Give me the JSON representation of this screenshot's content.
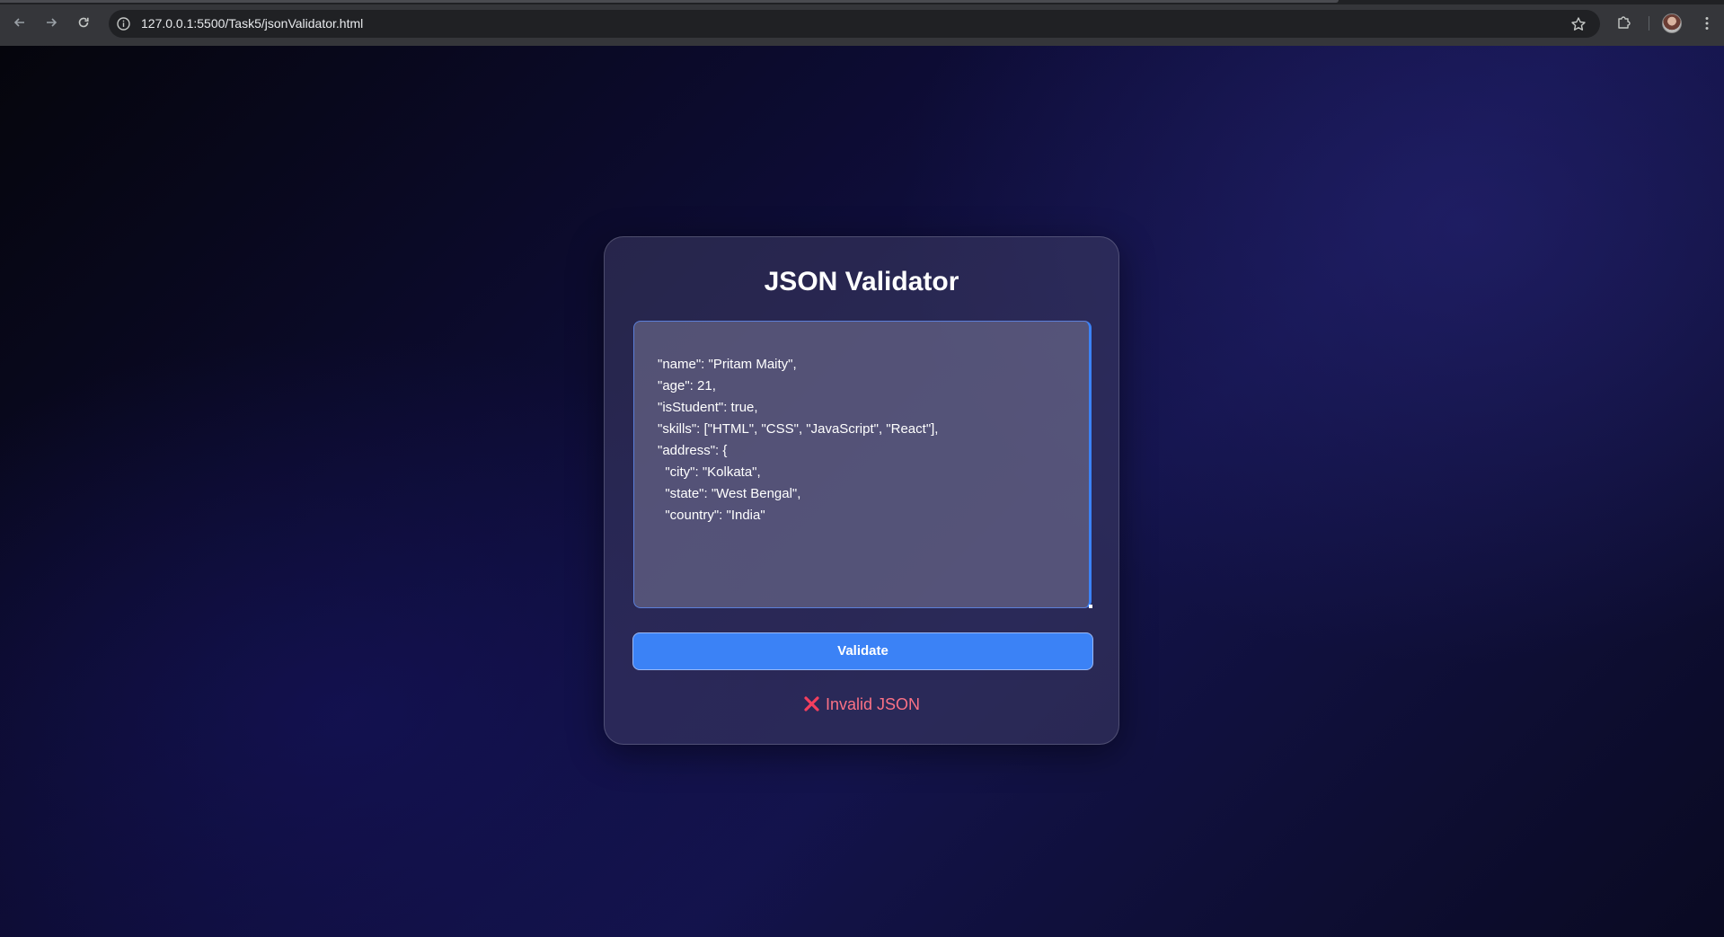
{
  "browser": {
    "url": "127.0.0.1:5500/Task5/jsonValidator.html",
    "icons": {
      "back": "arrow-left-icon",
      "forward": "arrow-right-icon",
      "reload": "reload-icon",
      "site_info": "info-icon",
      "bookmark": "star-icon",
      "extensions": "puzzle-icon",
      "profile": "avatar",
      "menu": "kebab-menu-icon"
    }
  },
  "app": {
    "title": "JSON Validator",
    "editor_value": "\"name\": \"Pritam Maity\",\n\"age\": 21,\n\"isStudent\": true,\n\"skills\": [\"HTML\", \"CSS\", \"JavaScript\", \"React\"],\n\"address\": {\n  \"city\": \"Kolkata\",\n  \"state\": \"West Bengal\",\n  \"country\": \"India\"",
    "validate_label": "Validate",
    "result_text": "Invalid JSON",
    "result_icon": "cross-icon"
  },
  "colors": {
    "accent": "#3b82f6",
    "error": "#fb7185"
  }
}
